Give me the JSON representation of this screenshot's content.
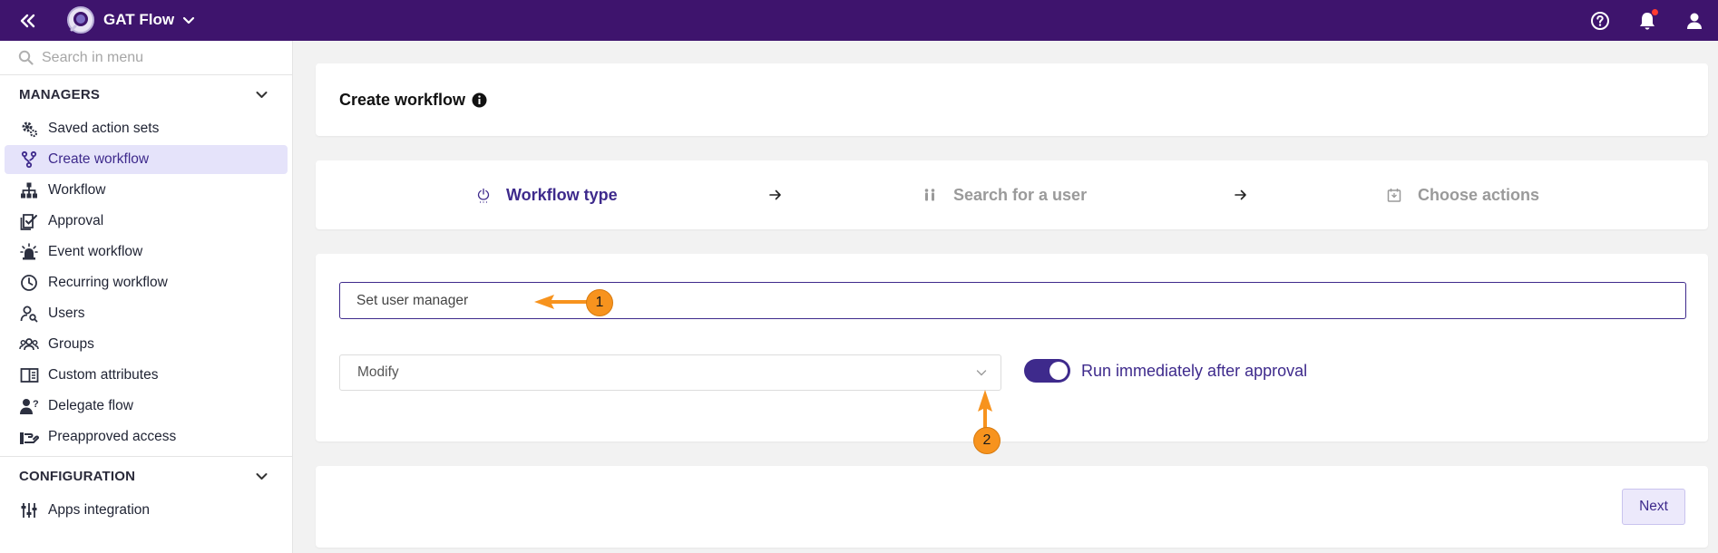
{
  "app": {
    "name": "GAT Flow"
  },
  "sidebar": {
    "search_placeholder": "Search in menu",
    "sections": [
      {
        "title": "MANAGERS",
        "items": [
          {
            "label": "Saved action sets",
            "icon": "gears-icon"
          },
          {
            "label": "Create workflow",
            "icon": "branch-icon",
            "active": true
          },
          {
            "label": "Workflow",
            "icon": "sitemap-icon"
          },
          {
            "label": "Approval",
            "icon": "approval-check-icon"
          },
          {
            "label": "Event workflow",
            "icon": "siren-icon"
          },
          {
            "label": "Recurring workflow",
            "icon": "clock-icon"
          },
          {
            "label": "Users",
            "icon": "user-search-icon"
          },
          {
            "label": "Groups",
            "icon": "groups-icon"
          },
          {
            "label": "Custom attributes",
            "icon": "book-open-icon"
          },
          {
            "label": "Delegate flow",
            "icon": "user-question-icon"
          },
          {
            "label": "Preapproved access",
            "icon": "hand-icon"
          }
        ]
      },
      {
        "title": "CONFIGURATION",
        "items": [
          {
            "label": "Apps integration",
            "icon": "sliders-icon"
          }
        ]
      }
    ]
  },
  "main": {
    "title": "Create workflow",
    "steps": [
      {
        "label": "Workflow type",
        "active": true,
        "icon": "power-icon"
      },
      {
        "label": "Search for a user",
        "active": false,
        "icon": "users-icon"
      },
      {
        "label": "Choose actions",
        "active": false,
        "icon": "calendar-icon"
      }
    ],
    "name_input": {
      "value": "Set user manager"
    },
    "select": {
      "value": "Modify"
    },
    "toggle": {
      "label": "Run immediately after approval",
      "on": true
    },
    "next_label": "Next"
  },
  "annotations": [
    {
      "number": "1"
    },
    {
      "number": "2"
    }
  ],
  "colors": {
    "topbar": "#3e146d",
    "accent": "#3e2a8c",
    "annotation": "#f7931e"
  }
}
